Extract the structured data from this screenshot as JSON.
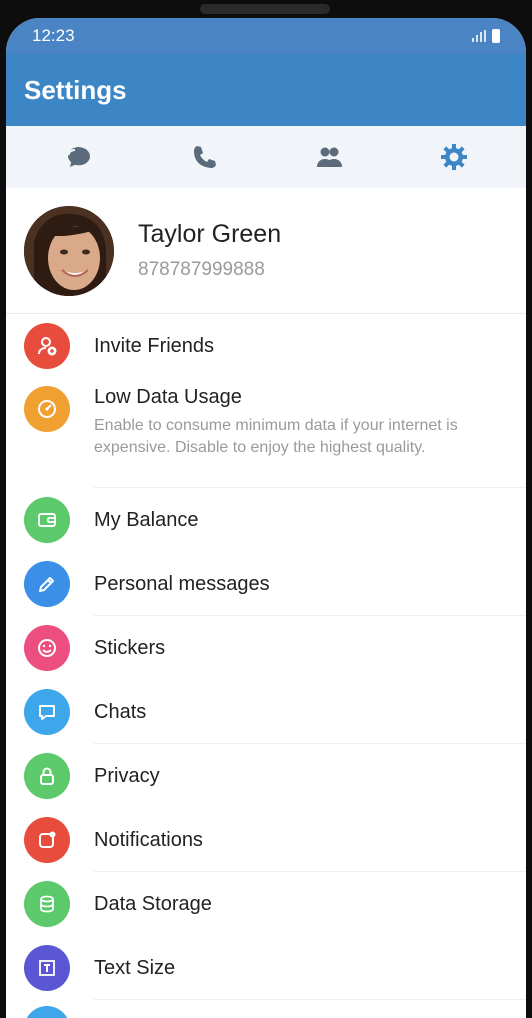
{
  "status_bar": {
    "time": "12:23"
  },
  "app_bar": {
    "title": "Settings"
  },
  "tabs": [
    {
      "icon": "chat-bubbles-icon"
    },
    {
      "icon": "phone-icon"
    },
    {
      "icon": "contacts-icon"
    },
    {
      "icon": "gear-icon",
      "active": true
    }
  ],
  "profile": {
    "name": "Taylor Green",
    "phone": "878787999888"
  },
  "menu": [
    {
      "label": "Invite Friends",
      "icon": "add-user-icon",
      "color": "#e74c3c"
    },
    {
      "label": "Low Data Usage",
      "subtitle": "Enable to consume minimum data if your internet is expensive. Disable to enjoy the highest quality.",
      "icon": "gauge-icon",
      "color": "#f0a030"
    },
    {
      "label": "My Balance",
      "icon": "wallet-icon",
      "color": "#5cc96a"
    },
    {
      "label": "Personal messages",
      "icon": "pencil-icon",
      "color": "#3b8fe6"
    },
    {
      "label": "Stickers",
      "icon": "smiley-icon",
      "color": "#ec4f7f"
    },
    {
      "label": "Chats",
      "icon": "chat-icon",
      "color": "#3ea6ea"
    },
    {
      "label": "Privacy",
      "icon": "lock-icon",
      "color": "#5cc96a"
    },
    {
      "label": "Notifications",
      "icon": "notification-icon",
      "color": "#e74c3c"
    },
    {
      "label": "Data Storage",
      "icon": "database-icon",
      "color": "#5cc96a"
    },
    {
      "label": "Text Size",
      "icon": "text-size-icon",
      "color": "#5b57d4"
    }
  ],
  "colors": {
    "status_bar": "#4a84c4",
    "app_bar": "#3d86c6",
    "tab_icon": "#5b6b7b",
    "tab_active": "#3d86c6"
  }
}
